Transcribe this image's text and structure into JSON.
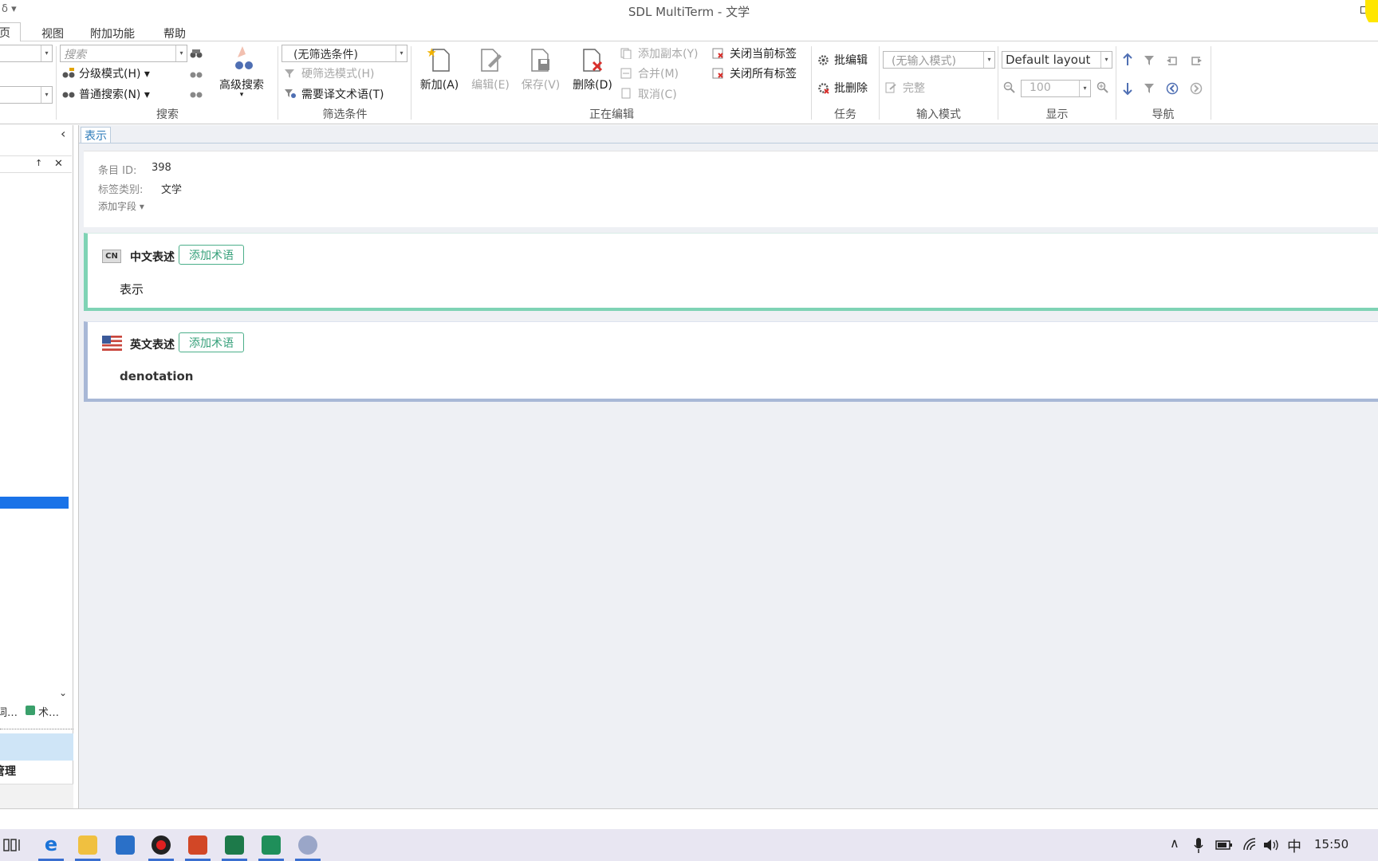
{
  "window": {
    "title": "SDL MultiTerm - 文学",
    "quickaccess": "δ ▾"
  },
  "menu": {
    "tabs": [
      "主页",
      "视图",
      "附加功能",
      "帮助"
    ],
    "active_partial": "页"
  },
  "ribbon": {
    "search": {
      "search_placeholder": "搜索",
      "hierarchical": "分级模式(H)",
      "normal": "普通搜索(N)",
      "advanced": "高级搜索",
      "group": "搜索"
    },
    "filter": {
      "selected": "(无筛选条件)",
      "hard_filter": "硬筛选模式(H)",
      "needs_translation": "需要译文术语(T)",
      "group": "筛选条件"
    },
    "editing": {
      "new": "新加(A)",
      "edit": "编辑(E)",
      "save": "保存(V)",
      "delete": "删除(D)",
      "add_copy": "添加副本(Y)",
      "merge": "合并(M)",
      "cancel": "取消(C)",
      "close_current": "关闭当前标签",
      "close_all": "关闭所有标签",
      "group": "正在编辑"
    },
    "tasks": {
      "batch_edit": "批编辑",
      "batch_delete": "批删除",
      "group": "任务"
    },
    "input_mode": {
      "selected": "(无输入模式)",
      "complete": "完整",
      "group": "输入模式"
    },
    "display": {
      "layout": "Default layout",
      "zoom": "100",
      "group": "显示"
    },
    "navigation": {
      "group": "导航"
    }
  },
  "leftpane": {
    "collapse": "‹",
    "pin": "↑",
    "close": "✕",
    "bottom_tabs": [
      "词…",
      "术…"
    ],
    "bottom_item": "管理"
  },
  "doc": {
    "tab": "表示",
    "entry_id_label": "条目 ID:",
    "entry_id": "398",
    "label_category_label": "标签类别:",
    "label_category": "文学",
    "add_field": "添加字段",
    "languages": [
      {
        "code": "CN",
        "name": "中文表述",
        "add_term": "添加术语",
        "term": "表示",
        "accent": "#7fd3b5"
      },
      {
        "code": "US",
        "name": "英文表述",
        "add_term": "添加术语",
        "term": "denotation",
        "accent": "#a8b8d6"
      }
    ]
  },
  "taskbar": {
    "ime": "中",
    "time": "15:50",
    "volume": "喉)"
  }
}
